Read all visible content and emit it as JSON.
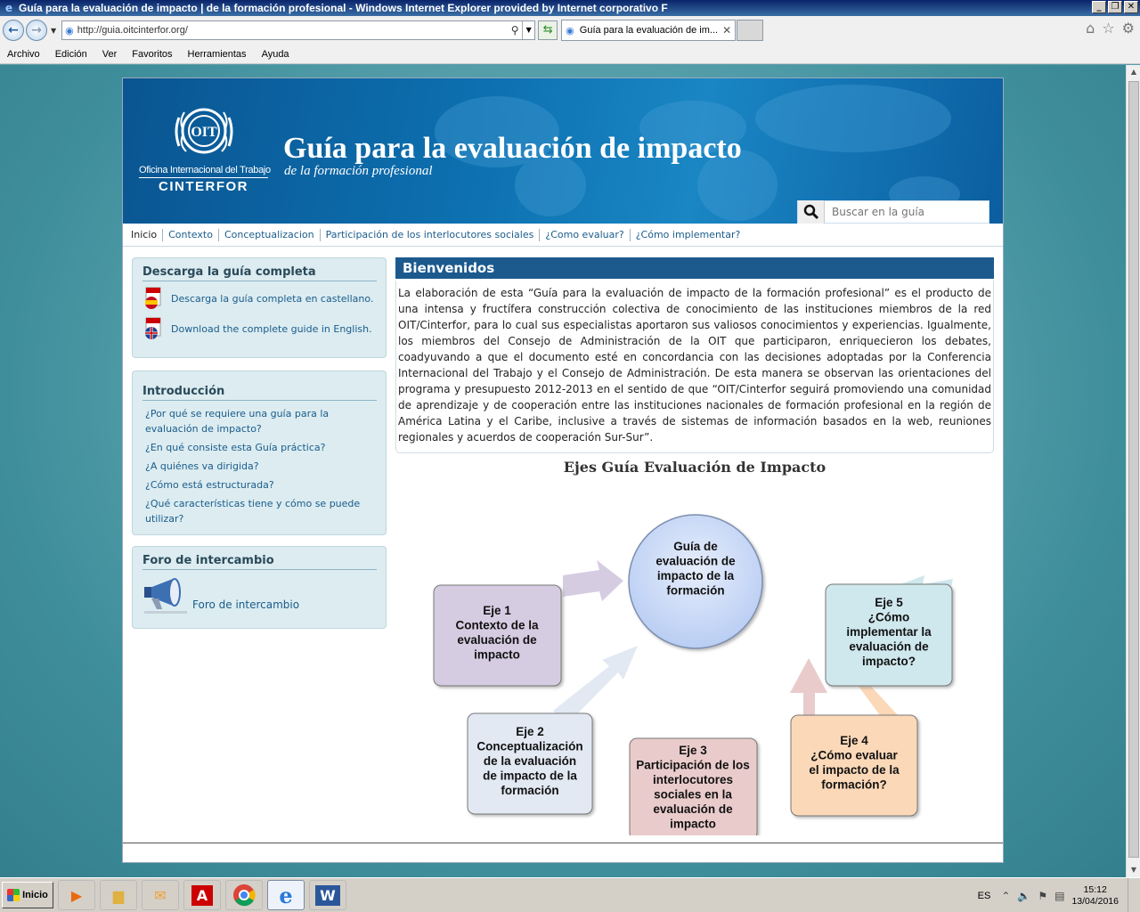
{
  "window": {
    "title": "Guía para la evaluación de impacto | de la formación profesional - Windows Internet Explorer provided by Internet corporativo F",
    "url": "http://guia.oitcinterfor.org/",
    "tab_label": "Guía para la evaluación de im...",
    "menu": [
      "Archivo",
      "Edición",
      "Ver",
      "Favoritos",
      "Herramientas",
      "Ayuda"
    ]
  },
  "header": {
    "org_name": "Oficina Internacional del Trabajo",
    "org_sub": "CINTERFOR",
    "title": "Guía para la evaluación de impacto",
    "subtitle": "de la formación profesional",
    "search_placeholder": "Buscar en la guía"
  },
  "nav": [
    "Inicio",
    "Contexto",
    "Conceptualizacion",
    "Participación de los interlocutores sociales",
    "¿Como evaluar?",
    "¿Cómo implementar?"
  ],
  "sidebar": {
    "download": {
      "title": "Descarga la guía completa",
      "links": [
        "Descarga la guía completa en castellano.",
        "Download the complete guide in English."
      ]
    },
    "intro": {
      "title": "Introducción",
      "links": [
        "¿Por qué se requiere una guía para la evaluación de impacto?",
        "¿En qué consiste esta Guía práctica?",
        "¿A quiénes va dirigida?",
        "¿Cómo está estructurada?",
        "¿Qué características tiene y cómo se puede utilizar?"
      ]
    },
    "forum": {
      "title": "Foro de intercambio",
      "link": "Foro de intercambio"
    }
  },
  "main": {
    "welcome_title": "Bienvenidos",
    "welcome_text": "La elaboración de esta “Guía para la evaluación de impacto de la formación profesional” es el producto de una intensa y fructífera construcción colectiva de conocimiento de las instituciones miembros de la red OIT/Cinterfor, para lo cual sus especialistas aportaron sus valiosos conocimientos y experiencias. Igualmente, los miembros del Consejo de Administración de la OIT que participaron, enriquecieron los debates, coadyuvando a que el documento esté en concordancia con las decisiones adoptadas por la Conferencia Internacional del Trabajo y el Consejo de Administración. De esta manera se observan las orientaciones del programa y presupuesto 2012-2013 en el sentido de que “OIT/Cinterfor seguirá promoviendo una comunidad de aprendizaje y de cooperación entre las instituciones nacionales de formación profesional en la región de América Latina y el Caribe, inclusive a través de sistemas de información basados en la web, reuniones regionales y acuerdos de cooperación Sur-Sur”.",
    "diagram_title": "Ejes Guía Evaluación de Impacto",
    "diagram": {
      "center": [
        "Guía de",
        "evaluación de",
        "impacto de la",
        "formación"
      ],
      "axes": [
        {
          "lines": [
            "Eje 1",
            "",
            "Contexto de la",
            "evaluación de",
            "impacto"
          ],
          "color": "#d6cce2"
        },
        {
          "lines": [
            "Eje 2",
            "",
            "Conceptualización",
            "de la evaluación",
            "de impacto de la",
            "formación"
          ],
          "color": "#e2e9f3"
        },
        {
          "lines": [
            "Eje 3",
            "",
            "Participación de los",
            "interlocutores",
            "sociales en la",
            "evaluación de",
            "impacto"
          ],
          "color": "#eacbcb"
        },
        {
          "lines": [
            "Eje 4",
            "",
            "¿Cómo evaluar",
            "el impacto de la",
            "formación?"
          ],
          "color": "#fbd8b8"
        },
        {
          "lines": [
            "Eje 5",
            "",
            "¿Cómo",
            "implementar la",
            "evaluación de",
            "impacto?"
          ],
          "color": "#cfe8ee"
        }
      ]
    }
  },
  "taskbar": {
    "start": "Inicio",
    "lang": "ES",
    "time": "15:12",
    "date": "13/04/2016"
  }
}
